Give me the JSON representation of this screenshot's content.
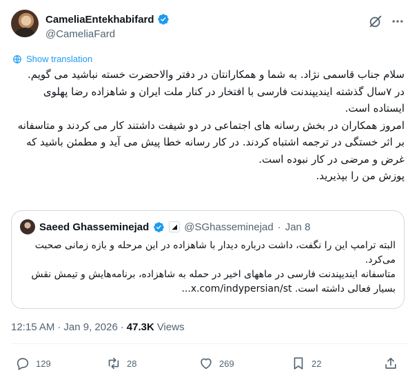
{
  "author": {
    "display_name": "CameliaEntekhabifard",
    "handle": "@CameliaFard"
  },
  "translate_label": "Show translation",
  "tweet_lines": [
    "سلام جناب قاسمی نژاد. به شما و همکارانتان در دفتر والاحضرت خسته نباشید می گویم.",
    "در ۷سال گذشته ایندیپندنت فارسی با افتخار در کنار ملت ایران و شاهزاده رضا پهلوی ایستاده است.",
    "امروز همکاران در بخش رسانه های اجتماعی در دو شیفت داشتند کار می کردند و متاسفانه بر اثر خستگی در ترجمه اشتباه کردند. در کار رسانه خطا پیش می آید و مطمئن باشید که غرض و مرضی در کار نبوده است.",
    "پوزش من را بپذیرید."
  ],
  "quote": {
    "display_name": "Saeed Ghasseminejad",
    "handle": "@SGhasseminejad",
    "date": "Jan 8",
    "lines": [
      "البته ترامپ این را نگفت، داشت درباره دیدار با شاهزاده در این مرحله و بازه زمانی صحبت می‌کرد.",
      "متاسفانه ایندیپندنت فارسی در ماههای اخیر در حمله به شاهزاده، برنامه‌هایش و تیمش نقش بسیار فعالی داشته است. x.com/indypersian/st..."
    ]
  },
  "meta": {
    "time": "12:15 AM",
    "date": "Jan 9, 2026",
    "views_count": "47.3K",
    "views_label": "Views"
  },
  "actions": {
    "replies": "129",
    "reposts": "28",
    "likes": "269",
    "bookmarks": "22"
  },
  "colors": {
    "accent": "#1d9bf0",
    "secondary_text": "#536471",
    "border": "#cfd9de"
  },
  "icons": [
    "verified-icon",
    "grok-icon",
    "more-icon",
    "globe-icon",
    "reply-icon",
    "repost-icon",
    "like-icon",
    "bookmark-icon",
    "share-icon"
  ]
}
